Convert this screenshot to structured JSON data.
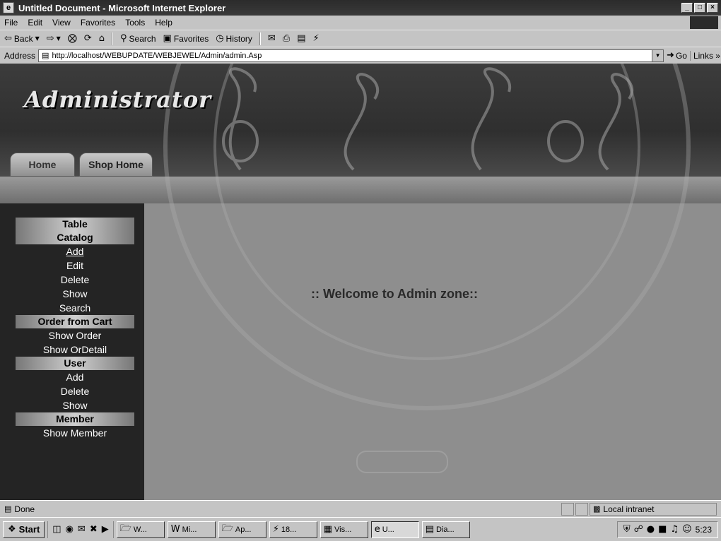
{
  "window": {
    "title": "Untitled Document - Microsoft Internet Explorer",
    "controls": [
      "_",
      "×"
    ]
  },
  "menubar": [
    "File",
    "Edit",
    "View",
    "Favorites",
    "Tools",
    "Help"
  ],
  "toolbar": {
    "back": "Back",
    "search": "Search",
    "favorites": "Favorites",
    "history": "History"
  },
  "address": {
    "label": "Address",
    "url": "http://localhost/WEBUPDATE/WEBJEWEL/Admin/admin.Asp",
    "go": "Go",
    "links": "Links »"
  },
  "page": {
    "site_title": "Administrator",
    "tabs": [
      "Home",
      "Shop Home"
    ],
    "welcome": ":: Welcome to Admin zone::"
  },
  "sidebar": {
    "table": {
      "headers": [
        "Table",
        "Catalog"
      ],
      "links": [
        "Add",
        "Edit",
        "Delete",
        "Show",
        "Search"
      ]
    },
    "order": {
      "header": "Order from Cart",
      "links": [
        "Show Order",
        "Show OrDetail"
      ]
    },
    "user": {
      "header": "User",
      "links": [
        "Add",
        "Delete",
        "Show"
      ]
    },
    "member": {
      "header": "Member",
      "links": [
        "Show Member"
      ]
    }
  },
  "status": {
    "text": "Done",
    "zone": "Local intranet"
  },
  "taskbar": {
    "start": "Start",
    "tasks": [
      "W...",
      "Mi...",
      "Ap...",
      "18...",
      "Vis...",
      "U...",
      "Dia..."
    ],
    "clock": "5:23"
  },
  "icons": {
    "back": "back-arrow-icon",
    "forward": "forward-arrow-icon",
    "stop": "stop-icon",
    "refresh": "refresh-icon",
    "home": "home-icon"
  }
}
